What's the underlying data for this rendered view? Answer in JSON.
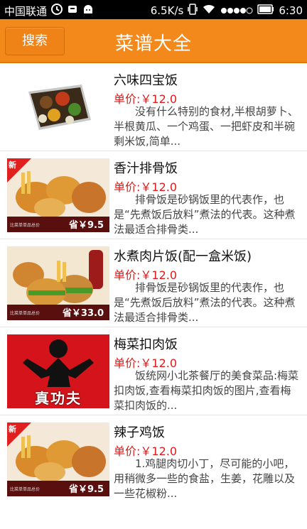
{
  "status": {
    "carrier": "中国联通",
    "speed": "6.5K/s",
    "time": "6:30"
  },
  "header": {
    "search_label": "搜索",
    "title": "菜谱大全"
  },
  "colors": {
    "header": "#f3891b",
    "price": "#e01a1a"
  },
  "items": [
    {
      "name": "六味四宝饭",
      "price": "单价:￥12.0",
      "desc": "没有什么特别的食材,半根胡萝卜、半根黄瓜、一个鸡蛋、一把虾皮和半碗剩米饭,简单..."
    },
    {
      "name": "香汁排骨饭",
      "price": "单价:￥12.0",
      "desc": "排骨饭是砂锅饭里的代表作，也是“先煮饭后放料”煮法的代表。这种煮法最适合排骨类...",
      "badge": "新",
      "strip_small": "比菜单单品总价",
      "strip_price": "省￥9.5"
    },
    {
      "name": "水煮肉片饭(配一盒米饭)",
      "price": "单价:￥12.0",
      "desc": "排骨饭是砂锅饭里的代表作，也是“先煮饭后放料”煮法的代表。这种煮法最适合排骨类...",
      "strip_small": "比菜单单品总价",
      "strip_price": "省￥33.0"
    },
    {
      "name": "梅菜扣肉饭",
      "price": "单价:￥12.0",
      "desc": "饭统网小北茶餐厅的美食菜品:梅菜扣肉饭,查看梅菜扣肉饭的图片,查看梅菜扣肉饭的...",
      "logo_text": "真功夫"
    },
    {
      "name": "辣子鸡饭",
      "price": "单价:￥12.0",
      "desc": "1.鸡腿肉切小丁，尽可能的小吧，用稍微多一些的食盐，生姜，花雕以及一些花椒粉...",
      "badge": "新",
      "strip_small": "比菜单单品总价",
      "strip_price": "省￥9.5"
    }
  ]
}
